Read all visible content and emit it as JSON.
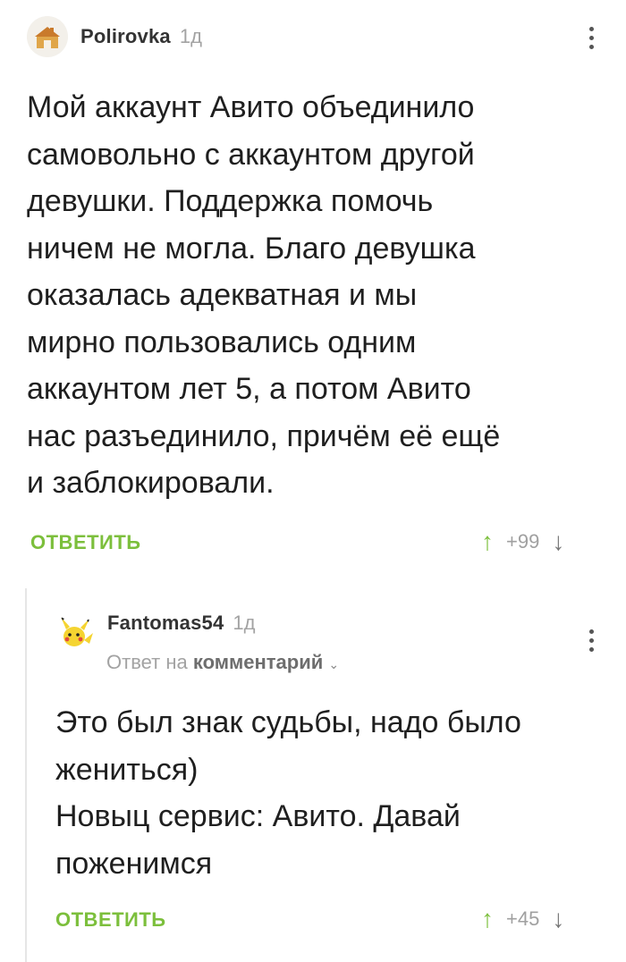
{
  "comments": [
    {
      "author": "Polirovka",
      "time": "1д",
      "text": "Мой аккаунт Авито объединило\nсамовольно с аккаунтом другой\nдевушки. Поддержка помочь\nничем не могла. Благо девушка\nоказалась адекватная и мы\nмирно пользовались одним\nаккаунтом лет 5, а потом Авито\nнас разъединило, причём её ещё\nи заблокировали.",
      "reply_label": "ОТВЕТИТЬ",
      "rating": "+99",
      "avatar_icon": "house-avatar-icon"
    },
    {
      "author": "Fantomas54",
      "time": "1д",
      "reply_to_prefix": "Ответ на",
      "reply_to_target": "комментарий",
      "text": "Это был знак судьбы, надо было\nжениться)\nНовыц сервис: Авито. Давай\nпоженимся",
      "reply_label": "ОТВЕТИТЬ",
      "rating": "+45",
      "avatar_icon": "pikachu-avatar-icon"
    }
  ],
  "colors": {
    "accent_green": "#7cbf3c",
    "muted_text": "#a3a3a3",
    "thread_line": "#e6e6e6"
  }
}
